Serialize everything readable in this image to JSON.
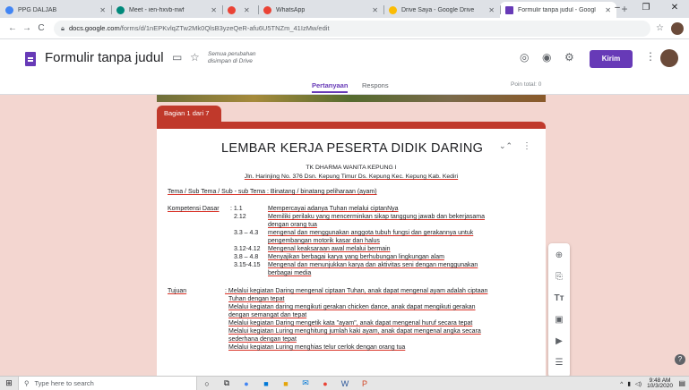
{
  "browser": {
    "tabs": [
      {
        "title": "PPG DALJAB",
        "color": "#4285f4",
        "active": false
      },
      {
        "title": "Meet - ien-hxvb-nwf",
        "color": "#00897b",
        "active": false
      },
      {
        "title": "",
        "color": "#ea4335",
        "active": false
      },
      {
        "title": "WhatsApp",
        "color": "#ea4335",
        "active": false
      },
      {
        "title": "Drive Saya - Google Drive",
        "color": "#fbbc04",
        "active": false
      },
      {
        "title": "Formulir tanpa judul - Googl",
        "color": "#673ab7",
        "active": true
      }
    ],
    "url_domain": "docs.google.com",
    "url_path": "/forms/d/1nEPKvlqZTw2Mk0QlsB3yzeQeR-afu6U5TNZm_41IzMw/edit",
    "back_icon": "arrow-left-icon",
    "forward_icon": "arrow-right-icon",
    "reload_icon": "reload-icon"
  },
  "form_header": {
    "title": "Formulir tanpa judul",
    "saved_status": "Semua perubahan disimpan di Drive",
    "send_label": "Kirim",
    "send_color": "#673ab7",
    "tabs": [
      "Pertanyaan",
      "Respons"
    ],
    "points": "Poin total: 0"
  },
  "section": {
    "label": "Bagian 1 dari 7",
    "color": "#c0392b"
  },
  "card": {
    "title": "LEMBAR KERJA PESERTA DIDIK DARING",
    "school": "TK DHARMA WANITA KEPUNG I",
    "address": "Jln. Harinjing No. 376 Dsn. Kepung Timur Ds. Kepung Kec. Kepung Kab. Kediri",
    "tema": "Tema / Sub Tema / Sub - sub Tema : Binatang / binatang peliharaan (ayam)",
    "kompetensi_label": "Kompetensi Dasar",
    "kompetensi": [
      {
        "code": ": 1.1",
        "text": "Mempercayai adanya Tuhan melalui ciptanNya"
      },
      {
        "code": "2.12",
        "text": "Memiliki perilaku yang mencerminkan sikap tanggung jawab dan bekerjasama"
      },
      {
        "code": "",
        "text": "dengan orang tua"
      },
      {
        "code": "3.3 – 4.3",
        "text": "mengenal dan menggunakan anggota tubuh fungsi dan gerakannya untuk"
      },
      {
        "code": "",
        "text": "pengembangan motorik kasar dan halus"
      },
      {
        "code": "3.12-4.12",
        "text": "Mengenal keaksaraan awal melalui bermain"
      },
      {
        "code": "3.8 – 4.8",
        "text": "Menyajikan berbagai karya yang berhubungan lingkungan alam"
      },
      {
        "code": "3.15-4.15",
        "text": "Mengenal dan menunjukkan karya dan aktivitas seni dengan menggunakan"
      },
      {
        "code": "",
        "text": "berbagai media"
      }
    ],
    "tujuan_label": "Tujuan",
    "tujuan": [
      ": Melalui kegiatan Daring mengenal ciptaan Tuhan, anak dapat mengenal ayam adalah ciptaan",
      "Tuhan dengan tepat",
      "Melalui kegiatan daring mengikuti gerakan chicken dance, anak dapat mengikuti gerakan",
      "dengan semangat dan tepat",
      "Melalui kegiatan Daring mengetik kata \"ayam\", anak dapat mengenal huruf secara tepat",
      "Melalui kegiatan Luring menghitung jumlah kaki ayam, anak dapat mengenal angka secara",
      "sederhana dengan tepat",
      "Melalui kegiatan Luring menghias telur cerlok dengan orang tua"
    ]
  },
  "taskbar": {
    "search_placeholder": "Type here to search",
    "time": "9:48 AM",
    "date": "10/3/2020"
  }
}
